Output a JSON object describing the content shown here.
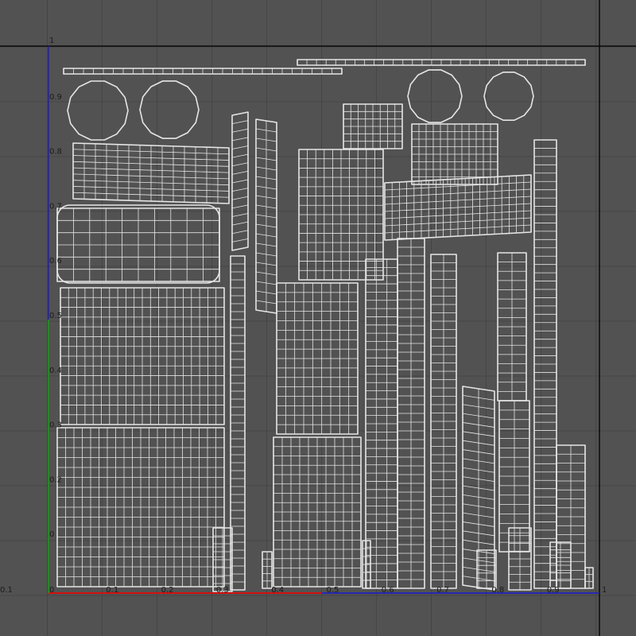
{
  "editor": {
    "view": "UV Texture Editor",
    "u_axis_labels": [
      "0.1",
      "0",
      "0.1",
      "0.2",
      "0.3",
      "0.4",
      "0.5",
      "0.6",
      "0.7",
      "0.8",
      "0.9",
      "1"
    ],
    "v_axis_labels": [
      "1",
      "0.9",
      "0.8",
      "0.7",
      "0.6",
      "0.5",
      "0.4",
      "0.3",
      "0.2",
      "0"
    ],
    "colors": {
      "background": "#525252",
      "grid": "#454545",
      "uv_wire": "#e6e6e6",
      "u_axis": "#d01010",
      "v_axis": "#0a9a0a",
      "border_blue": "#1a1ad0",
      "frame_black": "#0a0a0a"
    }
  }
}
